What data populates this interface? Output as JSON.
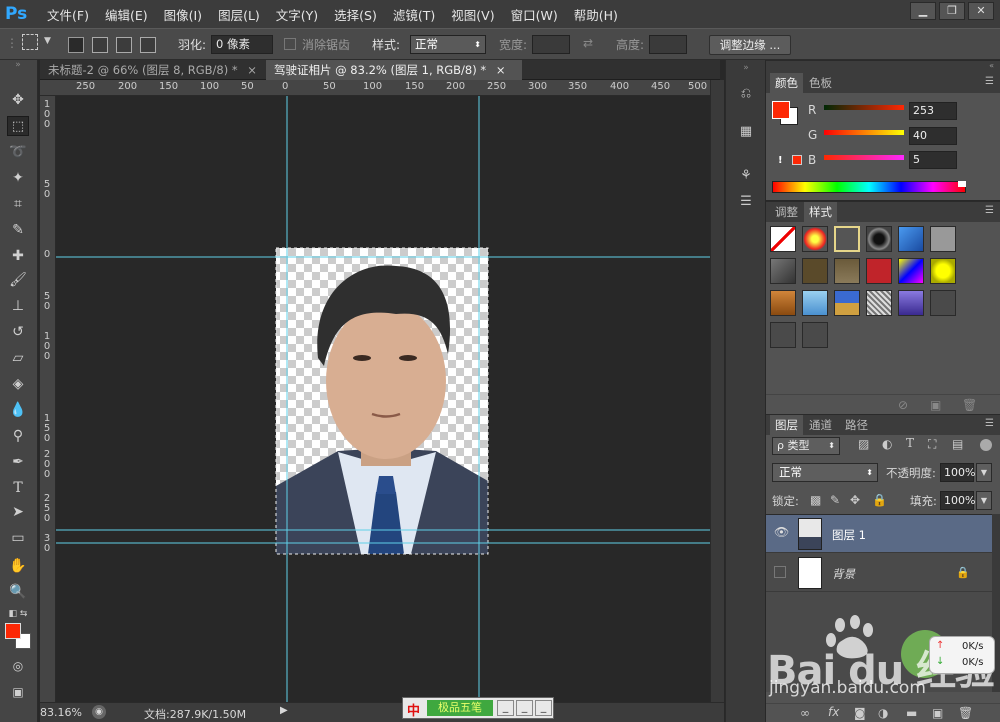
{
  "app": {
    "logo": "Ps"
  },
  "menu": [
    "文件(F)",
    "编辑(E)",
    "图像(I)",
    "图层(L)",
    "文字(Y)",
    "选择(S)",
    "滤镜(T)",
    "视图(V)",
    "窗口(W)",
    "帮助(H)"
  ],
  "window_controls": [
    "▁",
    "❐",
    "✕"
  ],
  "options": {
    "feather_label": "羽化:",
    "feather_value": "0 像素",
    "antialias_label": "消除锯齿",
    "style_label": "样式:",
    "style_value": "正常",
    "width_label": "宽度:",
    "height_label": "高度:",
    "refine_button": "调整边缘 ..."
  },
  "tabs": [
    {
      "label": "未标题-2 @ 66% (图层 8, RGB/8) *",
      "close": "×"
    },
    {
      "label": "驾驶证相片 @ 83.2% (图层 1, RGB/8) *",
      "close": "×"
    }
  ],
  "ruler": {
    "h_ticks": [
      "250",
      "200",
      "150",
      "100",
      "50",
      "0",
      "50",
      "100",
      "150",
      "200",
      "250",
      "300",
      "350",
      "400",
      "450",
      "500"
    ],
    "v_ticks": [
      {
        "digits": [
          "1",
          "0",
          "0"
        ]
      },
      {
        "digits": [
          "5",
          "0"
        ]
      },
      {
        "digits": [
          "0"
        ]
      },
      {
        "digits": [
          "5",
          "0"
        ]
      },
      {
        "digits": [
          "1",
          "0",
          "0"
        ]
      },
      {
        "digits": [
          "1",
          "5",
          "0"
        ]
      },
      {
        "digits": [
          "2",
          "0",
          "0"
        ]
      },
      {
        "digits": [
          "2",
          "5",
          "0"
        ]
      },
      {
        "digits": [
          "3",
          "0"
        ]
      }
    ]
  },
  "status": {
    "zoom": "83.16%",
    "doc": "文档:287.9K/1.50M"
  },
  "ime": {
    "badge": "中",
    "label": "极品五笔"
  },
  "color_panel": {
    "tabs": [
      "颜色",
      "色板"
    ],
    "fg_color": "#fd2805",
    "bg_color": "#ffffff",
    "channels": [
      {
        "label": "R",
        "value": "253"
      },
      {
        "label": "G",
        "value": "40"
      },
      {
        "label": "B",
        "value": "5"
      }
    ],
    "warning": "!"
  },
  "styles_panel": {
    "tabs": [
      "调整",
      "样式"
    ]
  },
  "layers_panel": {
    "tabs": [
      "图层",
      "通道",
      "路径"
    ],
    "filter_label": "ρ 类型",
    "blend_mode": "正常",
    "opacity_label": "不透明度:",
    "opacity_value": "100%",
    "lock_label": "锁定:",
    "fill_label": "填充:",
    "fill_value": "100%",
    "layers": [
      {
        "name": "图层 1",
        "visible": true,
        "selected": true
      },
      {
        "name": "背景",
        "visible": false,
        "selected": false
      }
    ],
    "footer_icons": [
      "link-icon",
      "fx-icon",
      "mask-icon",
      "adjustment-icon",
      "folder-icon",
      "new-layer-icon",
      "trash-icon"
    ]
  },
  "watermark": {
    "brand": "Bai du 经验",
    "url": "jingyan.baidu.com",
    "speed_up": "0K/s",
    "speed_down": "0K/s"
  }
}
